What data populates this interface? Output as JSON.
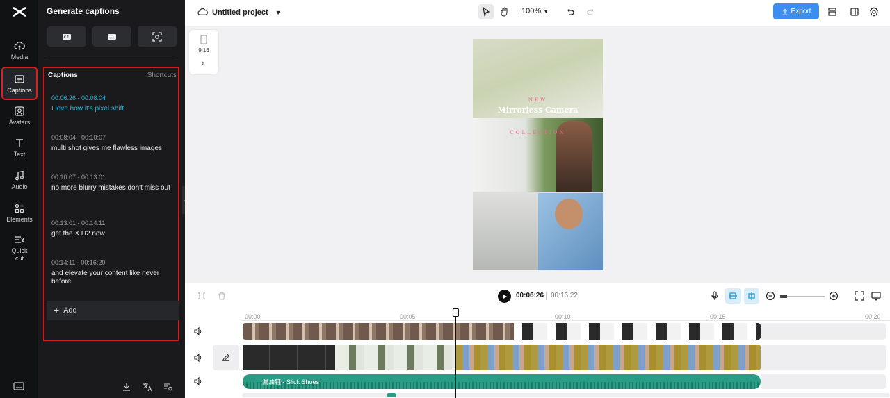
{
  "rail": {
    "items": [
      {
        "label": "Media",
        "icon": "cloud-upload-icon"
      },
      {
        "label": "Captions",
        "icon": "captions-icon",
        "active": true
      },
      {
        "label": "Avatars",
        "icon": "avatar-icon"
      },
      {
        "label": "Text",
        "icon": "text-icon"
      },
      {
        "label": "Audio",
        "icon": "music-note-icon"
      },
      {
        "label": "Elements",
        "icon": "elements-grid-icon"
      },
      {
        "label": "Quick cut",
        "icon": "quick-cut-icon"
      }
    ]
  },
  "panel": {
    "title": "Generate captions",
    "captions_header": "Captions",
    "shortcuts": "Shortcuts",
    "captions": [
      {
        "time": "00:06:26 - 00:08:04",
        "text": "I love how it's pixel shift"
      },
      {
        "time": "00:08:04 - 00:10:07",
        "text": "multi shot gives me flawless images"
      },
      {
        "time": "00:10:07 - 00:13:01",
        "text": "no more blurry mistakes don't miss out"
      },
      {
        "time": "00:13:01 - 00:14:11",
        "text": "get the X H2 now"
      },
      {
        "time": "00:14:11 - 00:16:20",
        "text": "and elevate your content like never before"
      }
    ],
    "add_label": "Add"
  },
  "topbar": {
    "project_name": "Untitled project",
    "zoom": "100%",
    "export_label": "Export"
  },
  "stage": {
    "ratio_label": "9:16",
    "video_text": {
      "line1": "NEW",
      "line2": "Mirrorless Camera",
      "line3": "COLLECTION"
    }
  },
  "timeline": {
    "current_time": "00:06:26",
    "total_time": "00:16:22",
    "ruler_ticks": [
      "00:00",
      "00:05",
      "00:10",
      "00:15",
      "00:20"
    ],
    "audio_track_label": "漏油鞋 - Slick Shoes"
  },
  "colors": {
    "accent": "#3b8ef0",
    "active_caption": "#2ab4d8",
    "highlight_border": "#d41c1c",
    "audio_track": "#2a9d86"
  }
}
